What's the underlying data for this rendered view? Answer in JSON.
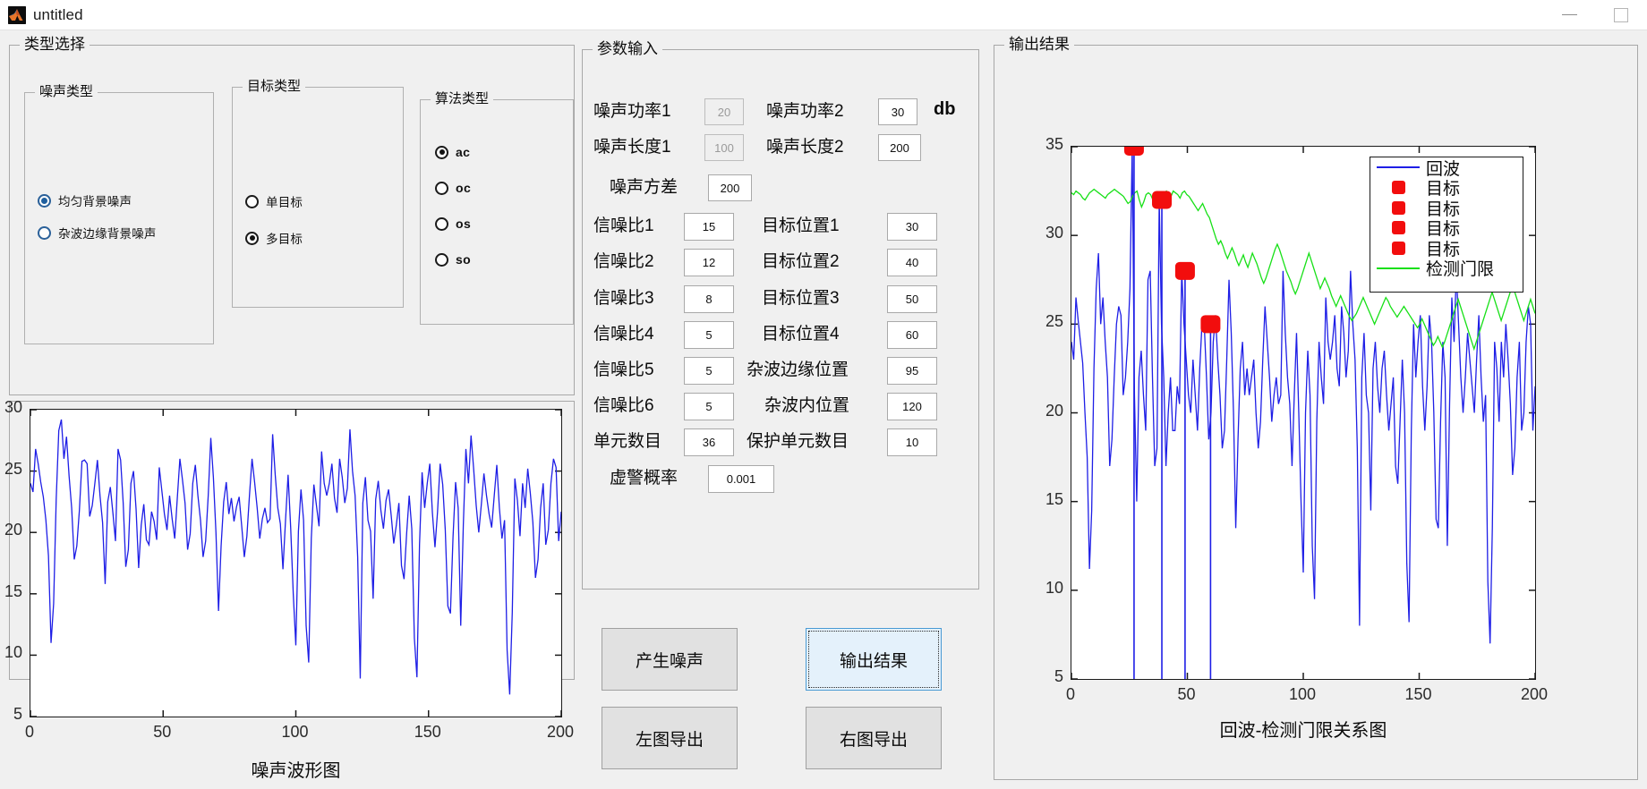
{
  "window": {
    "title": "untitled",
    "icon": "matlab-icon",
    "minimize": "−",
    "maximize": "□"
  },
  "panels": {
    "type_select": "类型选择",
    "param_input": "参数输入",
    "output_result": "输出结果",
    "noise_type": "噪声类型",
    "target_type": "目标类型",
    "algo_type": "算法类型"
  },
  "noise_type_options": [
    {
      "label": "均匀背景噪声",
      "selected": true
    },
    {
      "label": "杂波边缘背景噪声",
      "selected": false
    }
  ],
  "target_type_options": [
    {
      "label": "单目标",
      "selected": false
    },
    {
      "label": "多目标",
      "selected": true
    }
  ],
  "algo_type_options": [
    {
      "label": "ac",
      "selected": true
    },
    {
      "label": "oc",
      "selected": false
    },
    {
      "label": "os",
      "selected": false
    },
    {
      "label": "so",
      "selected": false
    }
  ],
  "params": {
    "noise_power_1": {
      "label": "噪声功率1",
      "value": "20",
      "disabled": true
    },
    "noise_power_2": {
      "label": "噪声功率2",
      "value": "30",
      "disabled": false
    },
    "unit_db": "db",
    "noise_len_1": {
      "label": "噪声长度1",
      "value": "100",
      "disabled": true
    },
    "noise_len_2": {
      "label": "噪声长度2",
      "value": "200",
      "disabled": false
    },
    "noise_var": {
      "label": "噪声方差",
      "value": "200",
      "disabled": false
    },
    "snr_1": {
      "label": "信噪比1",
      "value": "15"
    },
    "snr_2": {
      "label": "信噪比2",
      "value": "12"
    },
    "snr_3": {
      "label": "信噪比3",
      "value": "8"
    },
    "snr_4": {
      "label": "信噪比4",
      "value": "5"
    },
    "snr_5": {
      "label": "信噪比5",
      "value": "5"
    },
    "snr_6": {
      "label": "信噪比6",
      "value": "5"
    },
    "tpos_1": {
      "label": "目标位置1",
      "value": "30"
    },
    "tpos_2": {
      "label": "目标位置2",
      "value": "40"
    },
    "tpos_3": {
      "label": "目标位置3",
      "value": "50"
    },
    "tpos_4": {
      "label": "目标位置4",
      "value": "60"
    },
    "clutter_edge_pos": {
      "label": "杂波边缘位置",
      "value": "95"
    },
    "clutter_in_pos": {
      "label": "杂波内位置",
      "value": "120"
    },
    "cell_count": {
      "label": "单元数目",
      "value": "36"
    },
    "guard_cell_count": {
      "label": "保护单元数目",
      "value": "10"
    },
    "false_alarm_prob": {
      "label": "虚警概率",
      "value": "0.001"
    }
  },
  "buttons": {
    "generate_noise": "产生噪声",
    "output_result": "输出结果",
    "export_left": "左图导出",
    "export_right": "右图导出"
  },
  "colors": {
    "echo_blue": "#1e1ee6",
    "target_red": "#f20d0d",
    "threshold_green": "#17e017",
    "panel_bg": "#f0f0f0",
    "focus_blue": "#4a9ad4"
  },
  "chart_data": [
    {
      "type": "line",
      "name": "noise-waveform-chart",
      "title": "噪声波形图",
      "xlabel": "",
      "ylabel": "",
      "xlim": [
        0,
        200
      ],
      "ylim": [
        5,
        30
      ],
      "xticks": [
        0,
        50,
        100,
        150,
        200
      ],
      "yticks": [
        5,
        10,
        15,
        20,
        25,
        30
      ],
      "grid": false,
      "series": [
        {
          "name": "噪声",
          "color": "#1e1ee6",
          "values": [
            24.0,
            23.3,
            26.8,
            25.6,
            24.1,
            22.9,
            21.0,
            18.1,
            11.0,
            14.2,
            22.7,
            28.3,
            29.2,
            26.0,
            27.8,
            24.6,
            22.0,
            17.8,
            18.9,
            21.8,
            25.8,
            25.9,
            25.6,
            21.3,
            22.2,
            24.0,
            25.9,
            23.0,
            20.8,
            15.8,
            22.5,
            23.7,
            21.6,
            19.3,
            26.8,
            25.9,
            22.4,
            17.2,
            18.6,
            24.0,
            25.0,
            21.9,
            17.1,
            20.6,
            22.3,
            19.4,
            19.0,
            21.7,
            20.9,
            19.4,
            25.3,
            23.4,
            21.5,
            20.2,
            23.0,
            21.1,
            19.5,
            22.8,
            26.0,
            24.3,
            22.4,
            18.6,
            19.9,
            24.0,
            25.5,
            23.0,
            21.0,
            18.0,
            19.3,
            23.0,
            27.7,
            24.5,
            20.0,
            13.6,
            18.9,
            22.5,
            24.1,
            21.5,
            22.8,
            20.9,
            22.1,
            22.9,
            20.5,
            18.0,
            19.7,
            23.0,
            26.0,
            24.1,
            22.0,
            19.5,
            21.1,
            22.0,
            20.8,
            21.1,
            28.0,
            24.7,
            22.0,
            20.7,
            17.0,
            21.0,
            24.7,
            20.4,
            15.0,
            10.8,
            20.1,
            23.5,
            21.0,
            12.4,
            9.4,
            19.5,
            23.9,
            22.2,
            20.5,
            26.6,
            24.0,
            23.0,
            24.0,
            25.6,
            22.8,
            21.6,
            26.0,
            24.5,
            22.4,
            23.6,
            28.4,
            25.0,
            23.0,
            18.0,
            8.1,
            22.4,
            24.5,
            21.0,
            20.1,
            14.6,
            22.7,
            24.2,
            21.8,
            20.3,
            22.6,
            23.5,
            21.4,
            19.1,
            20.6,
            22.4,
            17.3,
            16.2,
            19.9,
            23.0,
            20.3,
            11.4,
            8.2,
            19.0,
            24.9,
            22.0,
            24.0,
            25.6,
            21.6,
            18.8,
            21.7,
            25.6,
            23.9,
            20.2,
            14.0,
            13.4,
            19.6,
            24.1,
            22.0,
            12.4,
            20.6,
            26.8,
            24.0,
            27.9,
            25.2,
            22.2,
            20.0,
            22.3,
            24.8,
            23.0,
            21.5,
            20.4,
            23.0,
            25.5,
            22.0,
            19.5,
            21.0,
            10.4,
            6.8,
            13.5,
            24.4,
            22.6,
            19.7,
            24.0,
            22.0,
            25.2,
            23.2,
            20.8,
            16.3,
            17.8,
            22.0,
            24.0,
            19.0,
            20.2,
            24.0,
            26.0,
            25.3,
            19.3,
            21.7
          ]
        }
      ]
    },
    {
      "type": "line",
      "name": "echo-threshold-chart",
      "title": "回波-检测门限关系图",
      "xlabel": "",
      "ylabel": "",
      "xlim": [
        0,
        200
      ],
      "ylim": [
        5,
        35
      ],
      "xticks": [
        0,
        50,
        100,
        150,
        200
      ],
      "yticks": [
        5,
        10,
        15,
        20,
        25,
        30,
        35
      ],
      "grid": false,
      "legend": {
        "position": "top-right",
        "entries": [
          {
            "label": "回波",
            "type": "line",
            "color": "#1e1ee6"
          },
          {
            "label": "目标",
            "type": "marker",
            "color": "#f20d0d"
          },
          {
            "label": "目标",
            "type": "marker",
            "color": "#f20d0d"
          },
          {
            "label": "目标",
            "type": "marker",
            "color": "#f20d0d"
          },
          {
            "label": "目标",
            "type": "marker",
            "color": "#f20d0d"
          },
          {
            "label": "检测门限",
            "type": "line",
            "color": "#17e017"
          }
        ]
      },
      "series": [
        {
          "name": "回波",
          "color": "#1e1ee6",
          "values": [
            24.0,
            23.0,
            26.5,
            25.2,
            24.0,
            22.8,
            20.0,
            17.5,
            11.2,
            14.5,
            22.5,
            27.0,
            29.0,
            25.0,
            26.5,
            24.0,
            22.0,
            17.0,
            18.5,
            22.0,
            25.0,
            26.0,
            25.5,
            21.0,
            22.0,
            24.0,
            27.0,
            35.0,
            21.0,
            15.0,
            22.0,
            23.5,
            21.0,
            19.0,
            27.5,
            28.0,
            22.0,
            17.0,
            18.0,
            32.0,
            25.0,
            22.0,
            17.0,
            20.0,
            22.0,
            19.0,
            19.0,
            21.5,
            20.5,
            28.0,
            25.0,
            23.0,
            21.0,
            20.0,
            23.0,
            21.0,
            19.0,
            22.5,
            25.0,
            25.0,
            22.0,
            18.5,
            20.0,
            24.0,
            25.5,
            23.0,
            21.0,
            18.0,
            19.0,
            23.0,
            27.5,
            24.5,
            20.0,
            13.5,
            18.5,
            22.5,
            24.0,
            21.0,
            22.5,
            21.0,
            22.0,
            23.0,
            20.0,
            18.0,
            19.5,
            23.0,
            26.0,
            24.0,
            22.0,
            19.5,
            21.0,
            22.0,
            20.5,
            21.0,
            28.0,
            24.5,
            22.0,
            20.5,
            17.0,
            21.0,
            24.5,
            20.0,
            15.0,
            11.0,
            20.0,
            23.5,
            21.0,
            12.5,
            9.5,
            19.5,
            24.0,
            22.0,
            20.5,
            26.5,
            24.0,
            23.0,
            24.0,
            25.5,
            22.5,
            21.5,
            26.0,
            24.5,
            22.0,
            23.5,
            28.0,
            25.0,
            23.0,
            18.0,
            8.0,
            22.0,
            24.5,
            21.0,
            20.0,
            14.5,
            22.5,
            24.0,
            21.5,
            20.0,
            22.5,
            23.5,
            21.0,
            19.0,
            20.5,
            22.0,
            17.0,
            16.0,
            19.5,
            23.0,
            20.0,
            11.5,
            8.2,
            19.0,
            25.0,
            22.0,
            24.0,
            25.5,
            21.5,
            19.0,
            21.5,
            25.5,
            24.0,
            20.0,
            14.0,
            13.5,
            19.5,
            24.0,
            22.0,
            12.5,
            20.5,
            26.5,
            24.0,
            28.0,
            25.0,
            22.0,
            20.0,
            22.0,
            24.5,
            23.0,
            21.5,
            20.0,
            23.0,
            25.5,
            22.0,
            19.5,
            21.0,
            10.5,
            7.0,
            13.5,
            24.0,
            22.5,
            19.5,
            24.0,
            22.0,
            25.0,
            23.0,
            20.5,
            16.5,
            18.0,
            22.0,
            24.0,
            19.0,
            20.0,
            24.0,
            26.0,
            25.0,
            19.0,
            21.5
          ]
        },
        {
          "name": "检测门限",
          "color": "#17e017",
          "values": [
            32.4,
            32.3,
            32.5,
            32.4,
            32.3,
            32.1,
            32.0,
            32.2,
            32.4,
            32.5,
            32.6,
            32.5,
            32.4,
            32.3,
            32.2,
            32.1,
            32.3,
            32.4,
            32.5,
            32.6,
            32.5,
            32.4,
            32.3,
            32.2,
            32.0,
            31.8,
            31.9,
            32.2,
            32.4,
            32.5,
            32.0,
            31.6,
            31.9,
            32.3,
            32.4,
            32.3,
            32.0,
            31.8,
            32.1,
            32.3,
            32.2,
            32.4,
            32.5,
            32.3,
            32.2,
            32.5,
            32.4,
            32.3,
            32.1,
            32.4,
            32.5,
            32.3,
            32.2,
            32.0,
            31.8,
            31.6,
            31.4,
            31.6,
            31.8,
            31.5,
            31.2,
            31.0,
            30.6,
            30.2,
            29.8,
            29.5,
            29.7,
            29.4,
            29.0,
            28.7,
            29.0,
            29.3,
            29.0,
            28.6,
            28.3,
            28.6,
            28.9,
            28.5,
            28.2,
            28.6,
            29.0,
            28.7,
            28.4,
            28.0,
            27.6,
            27.3,
            27.6,
            28.0,
            28.4,
            28.8,
            29.2,
            29.5,
            29.2,
            28.8,
            28.4,
            28.0,
            27.7,
            27.4,
            27.0,
            26.7,
            27.0,
            27.4,
            27.8,
            28.2,
            28.6,
            29.0,
            28.6,
            28.2,
            27.8,
            27.4,
            27.0,
            27.3,
            27.6,
            27.3,
            27.0,
            26.6,
            26.3,
            26.0,
            26.3,
            26.6,
            26.3,
            26.0,
            25.7,
            25.4,
            25.2,
            25.4,
            25.6,
            25.9,
            26.2,
            26.5,
            26.2,
            25.9,
            25.6,
            25.3,
            25.0,
            25.3,
            25.6,
            25.9,
            26.2,
            26.5,
            26.3,
            26.0,
            25.8,
            25.6,
            25.4,
            25.6,
            25.8,
            26.0,
            25.8,
            25.6,
            25.4,
            25.2,
            25.0,
            24.8,
            25.0,
            25.3,
            25.0,
            24.7,
            24.4,
            24.1,
            23.8,
            24.0,
            24.3,
            24.0,
            23.7,
            24.0,
            24.4,
            24.8,
            25.2,
            25.6,
            26.0,
            26.4,
            26.0,
            25.6,
            25.2,
            24.8,
            24.4,
            24.0,
            23.6,
            24.0,
            24.4,
            24.8,
            25.2,
            25.6,
            26.0,
            26.4,
            26.8,
            26.4,
            26.0,
            25.6,
            25.2,
            25.6,
            26.0,
            26.4,
            26.8,
            27.2,
            26.8,
            26.4,
            26.0,
            25.6,
            25.2,
            25.6,
            26.0,
            26.4,
            26.0,
            25.6
          ]
        }
      ],
      "markers": [
        {
          "name": "目标",
          "x": 27,
          "y": 35.0,
          "color": "#f20d0d"
        },
        {
          "name": "目标",
          "x": 39,
          "y": 32.0,
          "color": "#f20d0d"
        },
        {
          "name": "目标",
          "x": 49,
          "y": 28.0,
          "color": "#f20d0d"
        },
        {
          "name": "目标",
          "x": 60,
          "y": 25.0,
          "color": "#f20d0d"
        }
      ]
    }
  ]
}
